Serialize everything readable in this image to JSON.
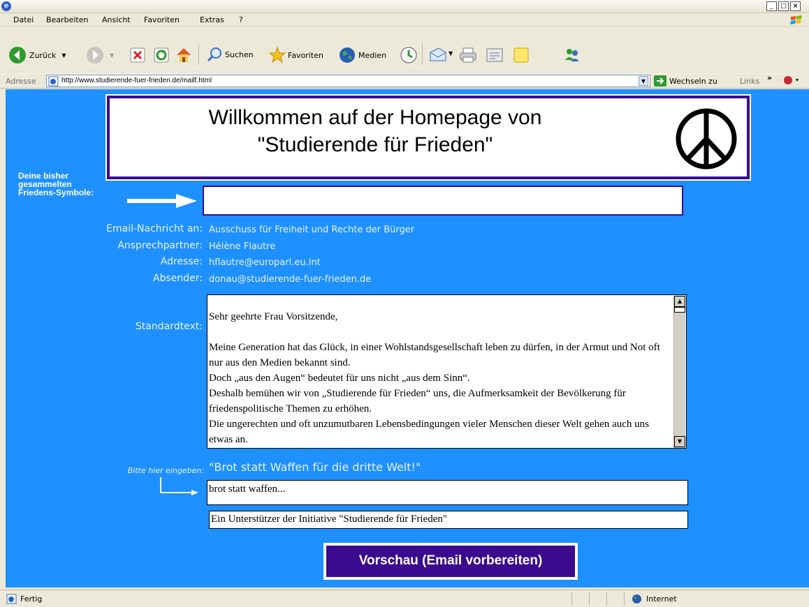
{
  "window": {
    "min": "_",
    "max": "□",
    "close": "×"
  },
  "menu": [
    "Datei",
    "Bearbeiten",
    "Ansicht",
    "Favoriten",
    "Extras",
    "?"
  ],
  "toolbar": {
    "back_label": "Zurück",
    "search_label": "Suchen",
    "favorites_label": "Favoriten",
    "media_label": "Medien"
  },
  "address": {
    "label": "Adresse",
    "url": "http://www.studierende-fuer-frieden.de/mailf.html",
    "go_label": "Wechseln zu",
    "links_label": "Links"
  },
  "page": {
    "banner_line1": "Willkommen auf der Homepage von",
    "banner_line2": "\"Studierende für Frieden\"",
    "symbols_label_1": "Deine bisher",
    "symbols_label_2": "gesammelten",
    "symbols_label_3": "Friedens-Symbole:",
    "fields": [
      {
        "label": "Email-Nachricht an:",
        "value": "Ausschuss für Freiheit und Rechte der Bürger"
      },
      {
        "label": "Ansprechpartner:",
        "value": "Hélène Flautre"
      },
      {
        "label": "Adresse:",
        "value": "hflautre@europarl.eu.int"
      },
      {
        "label": "Absender:",
        "value": "donau@studierende-fuer-frieden.de"
      }
    ],
    "standard_label": "Standardtext:",
    "standard_text": "Sehr geehrte Frau Vorsitzende,\n\nMeine Generation hat das Glück, in einer Wohlstandsgesellschaft leben zu dürfen, in der Armut und Not oft nur aus den Medien bekannt sind.\nDoch „aus den Augen“ bedeutet für uns nicht „aus dem Sinn“.\nDeshalb bemühen wir von „Studierende für Frieden“ uns, die Aufmerksamkeit der Bevölkerung für friedenspolitische Themen zu erhöhen.\nDie ungerechten und oft unzumutbaren Lebensbedingungen vieler Menschen dieser Welt gehen auch uns etwas an.",
    "input_hint": "Bitte hier eingeben:",
    "input_prompt": "\"Brot statt Waffen für die dritte Welt!\"",
    "input_value": "brot statt waffen...",
    "signature_value": "Ein Unterstützer der Initiative \"Studierende für Frieden\"",
    "submit_label": "Vorschau (Email vorbereiten)"
  },
  "status": {
    "left": "Fertig",
    "zone": "Internet"
  },
  "colors": {
    "page_bg": "#1e90ff",
    "accent": "#3b0a8f"
  }
}
